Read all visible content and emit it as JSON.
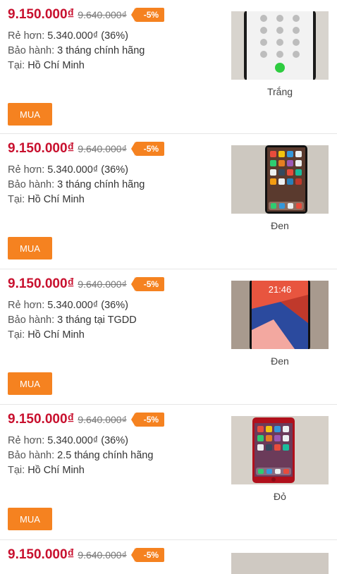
{
  "listings": [
    {
      "price": "9.150.000₫",
      "old_price": "9.640.000₫",
      "discount": "-5%",
      "savings_label": "Rẻ hơn: ",
      "savings_value": "5.340.000₫ (36%)",
      "warranty_label": "Bảo hành: ",
      "warranty_value": "3 tháng chính hãng",
      "location_label": "Tại: ",
      "location_value": "Hồ Chí Minh",
      "buy_label": "MUA",
      "color": "Trắng"
    },
    {
      "price": "9.150.000₫",
      "old_price": "9.640.000₫",
      "discount": "-5%",
      "savings_label": "Rẻ hơn: ",
      "savings_value": "5.340.000₫ (36%)",
      "warranty_label": "Bảo hành: ",
      "warranty_value": "3 tháng chính hãng",
      "location_label": "Tại: ",
      "location_value": "Hồ Chí Minh",
      "buy_label": "MUA",
      "color": "Đen"
    },
    {
      "price": "9.150.000₫",
      "old_price": "9.640.000₫",
      "discount": "-5%",
      "savings_label": "Rẻ hơn: ",
      "savings_value": "5.340.000₫ (36%)",
      "warranty_label": "Bảo hành: ",
      "warranty_value": "3 tháng tại TGDD",
      "location_label": "Tại: ",
      "location_value": "Hồ Chí Minh",
      "buy_label": "MUA",
      "color": "Đen",
      "photo_clock": "21:46"
    },
    {
      "price": "9.150.000₫",
      "old_price": "9.640.000₫",
      "discount": "-5%",
      "savings_label": "Rẻ hơn: ",
      "savings_value": "5.340.000₫ (36%)",
      "warranty_label": "Bảo hành: ",
      "warranty_value": "2.5 tháng chính hãng",
      "location_label": "Tại: ",
      "location_value": "Hồ Chí Minh",
      "buy_label": "MUA",
      "color": "Đỏ"
    },
    {
      "price": "9.150.000₫",
      "old_price": "9.640.000₫",
      "discount": "-5%"
    }
  ],
  "colors": {
    "price": "#c8102e",
    "accent": "#f58220",
    "divider": "#e6e6e6"
  }
}
